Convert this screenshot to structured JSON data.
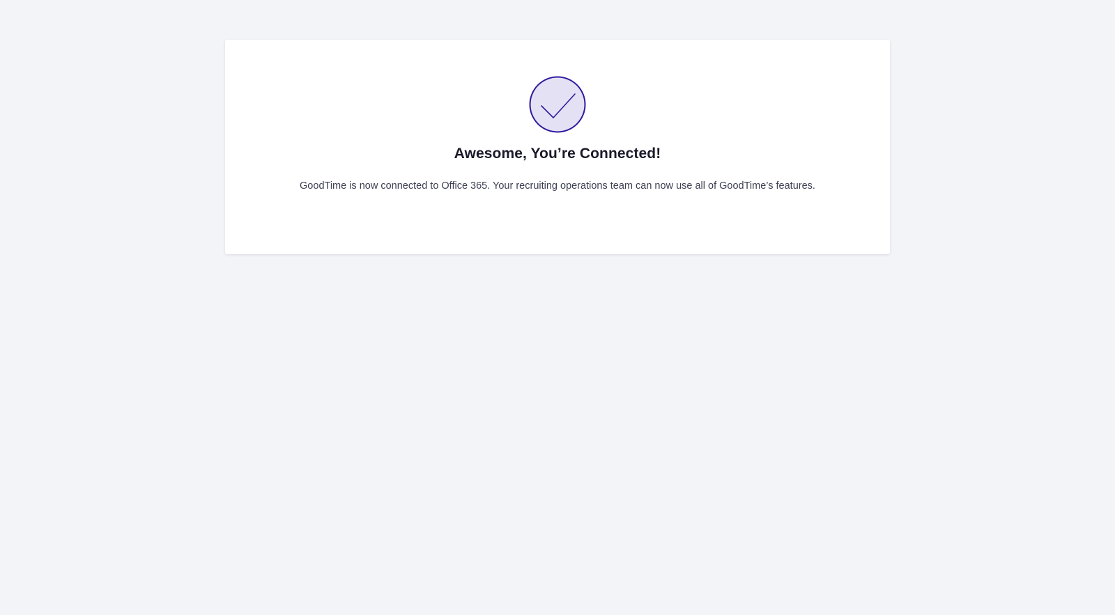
{
  "colors": {
    "page_background": "#f3f4f8",
    "card_background": "#ffffff",
    "accent": "#2e1c9e",
    "accent_fill": "#e5e1f4",
    "title_text": "#1a1a2b",
    "body_text": "#3b3f52"
  },
  "success": {
    "icon": "check-circle-icon",
    "title": "Awesome, You’re Connected!",
    "message": "GoodTime is now connected to Office 365. Your recruiting operations team can now use all of GoodTime’s features."
  }
}
